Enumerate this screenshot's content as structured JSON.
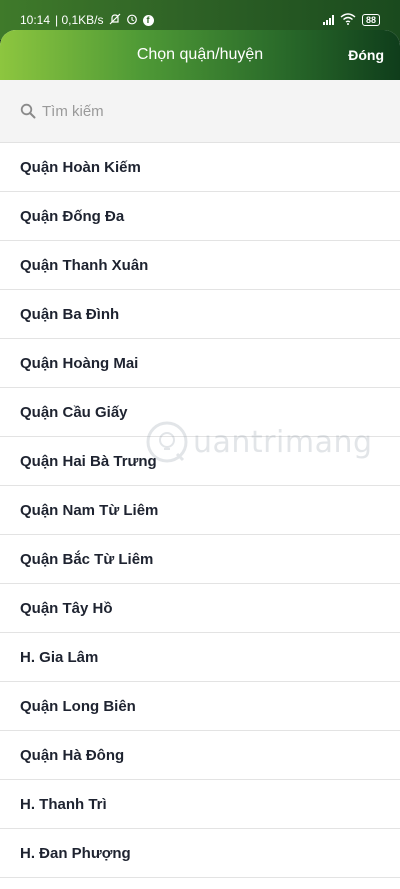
{
  "status_bar": {
    "time": "10:14",
    "network_speed": "| 0,1KB/s",
    "battery": "88",
    "icons": [
      "mute-icon",
      "alarm-icon",
      "facebook-icon",
      "signal-icon",
      "wifi-icon",
      "battery-icon"
    ]
  },
  "header": {
    "title": "Chọn quận/huyện",
    "close_label": "Đóng"
  },
  "search": {
    "placeholder": "Tìm kiếm"
  },
  "districts": [
    "Quận Hoàn Kiếm",
    "Quận Đống Đa",
    "Quận Thanh Xuân",
    "Quận Ba Đình",
    "Quận Hoàng Mai",
    "Quận Cầu Giấy",
    "Quận Hai Bà Trưng",
    "Quận Nam Từ Liêm",
    "Quận Bắc Từ Liêm",
    "Quận Tây Hồ",
    "H. Gia Lâm",
    "Quận Long Biên",
    "Quận Hà Đông",
    "H. Thanh Trì",
    "H. Đan Phượng"
  ],
  "watermark": "uantrimang",
  "colors": {
    "header_start": "#8dc63f",
    "header_end": "#0f3d1b",
    "item_text": "#1e2330"
  }
}
